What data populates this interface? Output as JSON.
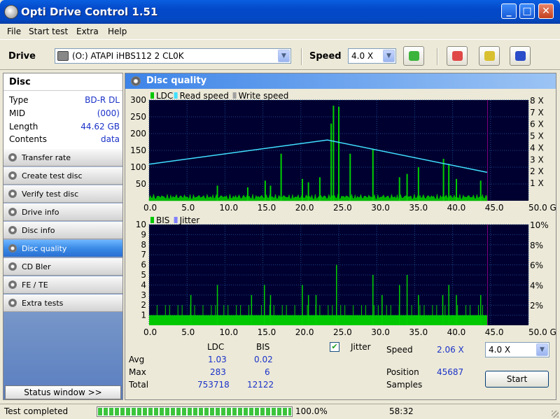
{
  "window": {
    "title": "Opti Drive Control 1.51",
    "min": "_",
    "max": "□",
    "close": "✕"
  },
  "menu": [
    "File",
    "Start test",
    "Extra",
    "Help"
  ],
  "toolbar": {
    "drive_label": "Drive",
    "drive_value": "(O:)  ATAPI iHBS112  2 CL0K",
    "speed_label": "Speed",
    "speed_value": "4.0 X"
  },
  "sidebar": {
    "heading": "Disc",
    "info": [
      {
        "k": "Type",
        "v": "BD-R DL"
      },
      {
        "k": "MID",
        "v": "(000)"
      },
      {
        "k": "Length",
        "v": "44.62 GB"
      },
      {
        "k": "Contents",
        "v": "data"
      }
    ],
    "items": [
      "Transfer rate",
      "Create test disc",
      "Verify test disc",
      "Drive info",
      "Disc info",
      "Disc quality",
      "CD Bler",
      "FE / TE",
      "Extra tests"
    ],
    "active": "Disc quality",
    "status_button": "Status window >>"
  },
  "panel": {
    "title": "Disc quality"
  },
  "chart_data": [
    {
      "type": "line",
      "legend": [
        "LDC",
        "Read speed",
        "Write speed"
      ],
      "legend_colors": [
        "#00c800",
        "#40e0ff",
        "#a0a0a0"
      ],
      "xlim": [
        0,
        50
      ],
      "x_ticks": [
        "0.0",
        "5.0",
        "10.0",
        "15.0",
        "20.0",
        "25.0",
        "30.0",
        "35.0",
        "40.0",
        "45.0",
        "50.0 GB"
      ],
      "ylim_left": [
        0,
        300
      ],
      "y_ticks_left": [
        "300",
        "250",
        "200",
        "150",
        "100",
        "50"
      ],
      "y_ticks_right": [
        "8 X",
        "7 X",
        "6 X",
        "5 X",
        "4 X",
        "3 X",
        "2 X",
        "1 X"
      ],
      "series": [
        {
          "name": "Read speed",
          "x": [
            0,
            23.5,
            44.6
          ],
          "y": [
            3.1,
            5.15,
            2.4
          ]
        }
      ],
      "ldc_spikes": [
        {
          "x": 9,
          "y": 45
        },
        {
          "x": 13,
          "y": 40
        },
        {
          "x": 15.3,
          "y": 60
        },
        {
          "x": 16,
          "y": 45
        },
        {
          "x": 17.4,
          "y": 140
        },
        {
          "x": 20.2,
          "y": 65
        },
        {
          "x": 21,
          "y": 55
        },
        {
          "x": 24.3,
          "y": 283
        },
        {
          "x": 25,
          "y": 280
        },
        {
          "x": 24,
          "y": 230
        },
        {
          "x": 22.5,
          "y": 70
        },
        {
          "x": 26.5,
          "y": 140
        },
        {
          "x": 29.5,
          "y": 155
        },
        {
          "x": 33,
          "y": 70
        },
        {
          "x": 34,
          "y": 80
        },
        {
          "x": 38.8,
          "y": 125
        },
        {
          "x": 39.5,
          "y": 110
        },
        {
          "x": 43.7,
          "y": 60
        },
        {
          "x": 40.5,
          "y": 65
        },
        {
          "x": 35.5,
          "y": 100
        }
      ]
    },
    {
      "type": "bar",
      "legend": [
        "BIS",
        "Jitter"
      ],
      "legend_colors": [
        "#00c800",
        "#8080ff"
      ],
      "xlim": [
        0,
        50
      ],
      "x_ticks": [
        "0.0",
        "5.0",
        "10.0",
        "15.0",
        "20.0",
        "25.0",
        "30.0",
        "35.0",
        "40.0",
        "45.0",
        "50.0 GB"
      ],
      "ylim_left": [
        0,
        10
      ],
      "y_ticks_left": [
        "10",
        "9",
        "8",
        "7",
        "6",
        "5",
        "4",
        "3",
        "2",
        "1"
      ],
      "y_ticks_right": [
        "10%",
        "8%",
        "6%",
        "4%",
        "2%"
      ],
      "bis_spikes": [
        {
          "x": 5.5,
          "y": 3
        },
        {
          "x": 9,
          "y": 4
        },
        {
          "x": 13.5,
          "y": 3
        },
        {
          "x": 15.2,
          "y": 4
        },
        {
          "x": 16,
          "y": 3
        },
        {
          "x": 20.2,
          "y": 4
        },
        {
          "x": 21,
          "y": 3
        },
        {
          "x": 22,
          "y": 3
        },
        {
          "x": 24.7,
          "y": 6
        },
        {
          "x": 29.5,
          "y": 5
        },
        {
          "x": 30.7,
          "y": 3
        },
        {
          "x": 33,
          "y": 4
        },
        {
          "x": 34,
          "y": 5
        },
        {
          "x": 35.5,
          "y": 3
        },
        {
          "x": 38.7,
          "y": 3
        },
        {
          "x": 39.5,
          "y": 4
        },
        {
          "x": 40.5,
          "y": 3
        },
        {
          "x": 43.7,
          "y": 3
        }
      ]
    }
  ],
  "stats": {
    "col_ldc": "LDC",
    "col_bis": "BIS",
    "rows": [
      {
        "label": "Avg",
        "ldc": "1.03",
        "bis": "0.02"
      },
      {
        "label": "Max",
        "ldc": "283",
        "bis": "6"
      },
      {
        "label": "Total",
        "ldc": "753718",
        "bis": "12122"
      }
    ],
    "jitter_label": "Jitter",
    "jitter_checked": "✔",
    "speed_label": "Speed",
    "speed_value": "2.06 X",
    "position_label": "Position",
    "position_value": "45687",
    "samples_label": "Samples",
    "speed_select": "4.0 X",
    "start": "Start"
  },
  "statusbar": {
    "text": "Test completed",
    "progress": 1.0,
    "percent": "100.0%",
    "elapsed": "58:32"
  }
}
